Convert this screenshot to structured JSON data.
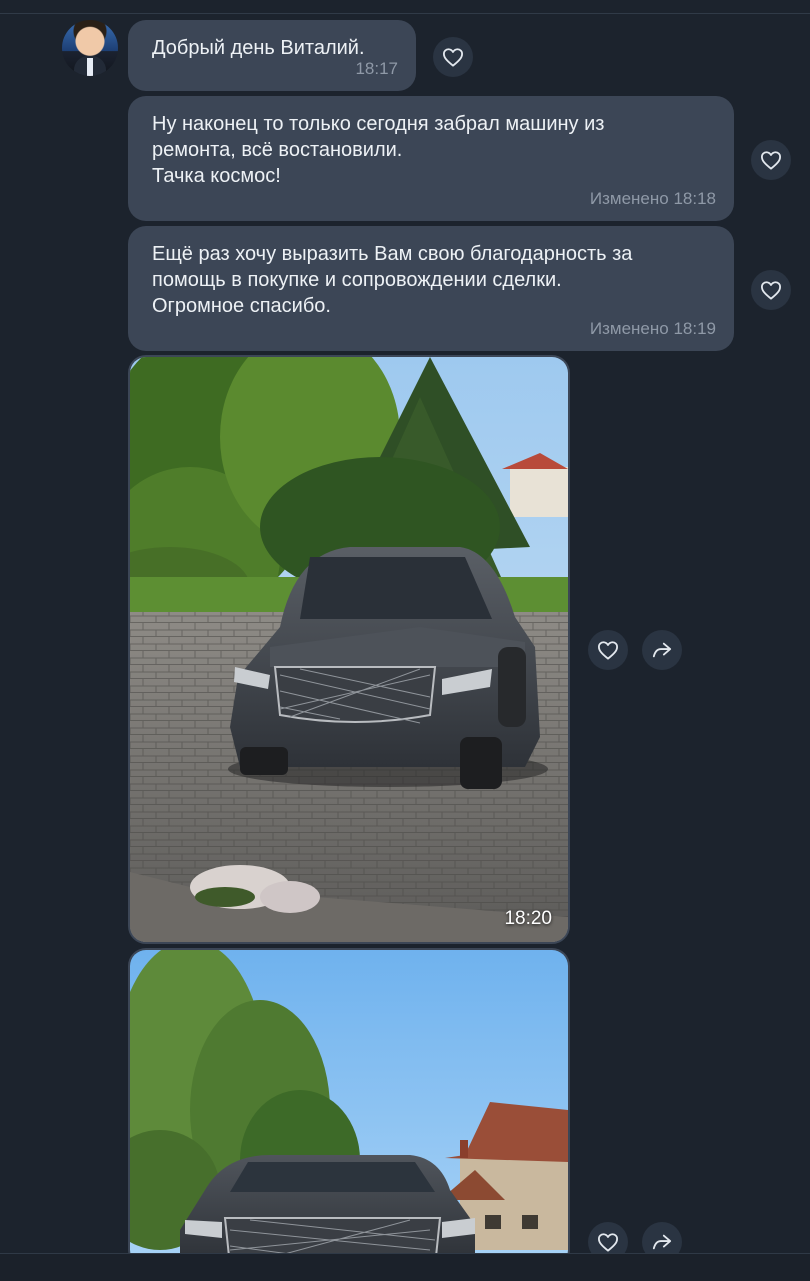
{
  "messages": [
    {
      "text": "Добрый день Виталий.",
      "time": "18:17"
    },
    {
      "text": "Ну наконец то только сегодня забрал машину из\nремонта, всё востановили.\nТачка космос!",
      "time": "Изменено 18:18"
    },
    {
      "text": "Ещё раз хочу выразить Вам свою благодарность за\nпомощь в покупке и сопровождении сделки.\nОгромное спасибо.",
      "time": "Изменено 18:19"
    }
  ],
  "photos": [
    {
      "time": "18:20"
    }
  ],
  "icons": {
    "like": "heart-icon",
    "share": "share-arrow-icon"
  },
  "colors": {
    "background": "#1c232d",
    "bubble": "#3c4656",
    "button": "#2a3442"
  }
}
